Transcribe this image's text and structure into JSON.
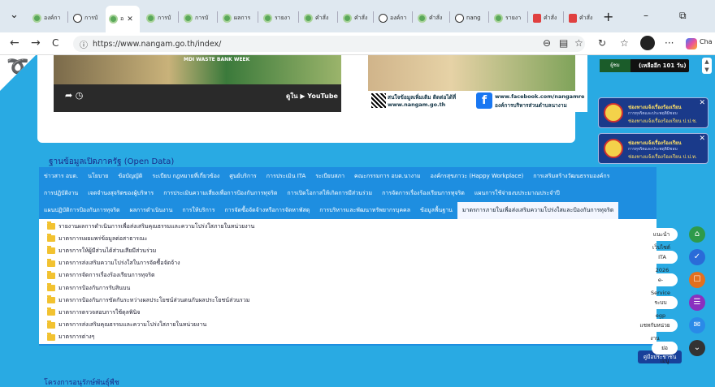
{
  "tabs": [
    {
      "label": "องค์กา",
      "icon": "green"
    },
    {
      "label": "การบั",
      "icon": "globe"
    },
    {
      "label": "อ",
      "icon": "green",
      "active": true
    },
    {
      "label": "การบั",
      "icon": "green"
    },
    {
      "label": "การบั",
      "icon": "green"
    },
    {
      "label": "ผลการ",
      "icon": "green"
    },
    {
      "label": "รายงา",
      "icon": "green"
    },
    {
      "label": "คำสั่ง",
      "icon": "green"
    },
    {
      "label": "คำสั่ง",
      "icon": "green"
    },
    {
      "label": "องค์กา",
      "icon": "globe"
    },
    {
      "label": "คำสั่ง",
      "icon": "green"
    },
    {
      "label": "nang",
      "icon": "globe"
    },
    {
      "label": "รายงา",
      "icon": "green"
    },
    {
      "label": "คำสั่ง",
      "icon": "pdf"
    },
    {
      "label": "คำสั่ง",
      "icon": "pdf"
    }
  ],
  "browser": {
    "url": "https://www.nangam.go.th/index/",
    "new_tab": "+",
    "minimize": "–",
    "restore": "⧉",
    "close": "✕",
    "tab_close": "✕",
    "dropdown": "⌄",
    "back": "←",
    "forward": "→",
    "reload": "C",
    "lock": "ⓘ",
    "more": "···",
    "copilot": "Cha"
  },
  "video": {
    "banner_text": "MDI WASTE BANK WEEK",
    "youtube": "ดูใน ▶ YouTube"
  },
  "info": {
    "line1": "สนใจข้อมูลเพิ่มเติม ติดต่อได้ที่",
    "line2": "www.nangam.go.th",
    "fb1": "www.facebook.com/nangamre",
    "fb2": "องค์การบริหารส่วนตำบลนางาม"
  },
  "visitor": {
    "label": "ผู้ชม",
    "count": "(เหลืออีก 101 วัน)"
  },
  "notifications": [
    {
      "t1": "ช่องทางแจ้งเรื่องร้องเรียน",
      "t2": "การทุจริตและประพฤติมิชอบ",
      "t3": "ช่องทางแจ้งเรื่องร้องเรียน ป.ป.ช."
    },
    {
      "t1": "ช่องทางแจ้งเรื่องร้องเรียน",
      "t2": "การทุจริตและประพฤติมิชอบ",
      "t3": "ช่องทางแจ้งเรื่องร้องเรียน ป.ป.ท."
    }
  ],
  "open_data_title": "ฐานข้อมูลเปิดภาครัฐ (Open Data)",
  "nav_rows": [
    [
      "ข่าวสาร อบต.",
      "นโยบาย",
      "ข้อบัญญัติ",
      "ระเบียบ กฎหมายที่เกี่ยวข้อง",
      "ศูนย์บริการ",
      "การประเมิน ITA",
      "ระเบียบสภา",
      "คณะกรรมการ อบต.นางาม",
      "องค์กรสุขภาวะ (Happy Workplace)",
      "การเสริมสร้างวัฒนธรรมองค์กร"
    ],
    [
      "การปฏิบัติงาน",
      "เจตจำนงสุจริตของผู้บริหาร",
      "การประเมินความเสี่ยงเพื่อการป้องกันการทุจริต",
      "การเปิดโอกาสให้เกิดการมีส่วนร่วม",
      "การจัดการเรื่องร้องเรียนการทุจริต",
      "แผนการใช้จ่ายงบประมาณประจำปี"
    ],
    [
      "แผนปฏิบัติการป้องกันการทุจริต",
      "ผลการดำเนินงาน",
      "การให้บริการ",
      "การจัดซื้อจัดจ้างหรือการจัดหาพัสดุ",
      "การบริหารและพัฒนาทรัพยากรบุคคล",
      "ข้อมูลพื้นฐาน",
      "มาตรการภายในเพื่อส่งเสริมความโปร่งใสและป้องกันการทุจริต"
    ]
  ],
  "list_items": [
    "รายงานผลการดำเนินการเพื่อส่งเสริมคุณธรรมและความโปร่งใสภายในหน่วยงาน",
    "มาตรการเผยแพร่ข้อมูลต่อสาธารณะ",
    "มาตรการให้ผู้มีส่วนได้ส่วนเสียมีส่วนร่วม",
    "มาตรการส่งเสริมความโปร่งใสในการจัดซื้อจัดจ้าง",
    "มาตรการจัดการเรื่องร้องเรียนการทุจริต",
    "มาตรการป้องกันการรับสินบน",
    "มาตรการป้องกันการขัดกันระหว่างผลประโยชน์ส่วนตนกับผลประโยชน์ส่วนรวม",
    "มาตรการตรวจสอบการใช้ดุลพินิจ",
    "มาตรการส่งเสริมคุณธรรมและความโปร่งใสภายในหน่วยงาน",
    "มาตรการต่างๆ"
  ],
  "side_buttons": [
    {
      "label": "แนะนำเว็บไซต์",
      "color": "#2e9a4a",
      "icon": "home-icon",
      "glyph": "⌂"
    },
    {
      "label": "ITA 2026",
      "color": "#2a6bd8",
      "icon": "compass-icon",
      "glyph": "✓"
    },
    {
      "label": "e-Service",
      "color": "#e2701f",
      "icon": "chat-icon",
      "glyph": "☐"
    },
    {
      "label": "ระบบ egp",
      "color": "#8a2fbf",
      "icon": "list-icon",
      "glyph": "☰"
    },
    {
      "label": "แชทกับหน่วยงาน",
      "color": "#2a8ae8",
      "icon": "messenger-icon",
      "glyph": "✉"
    },
    {
      "label": "ย่อเมนู",
      "color": "#333",
      "icon": "chevron-down-icon",
      "glyph": "⌄"
    }
  ],
  "manual_button": "คู่มือประชาชน",
  "bottom_title": "โครงการอนุรักษ์พันธุ์พืช"
}
